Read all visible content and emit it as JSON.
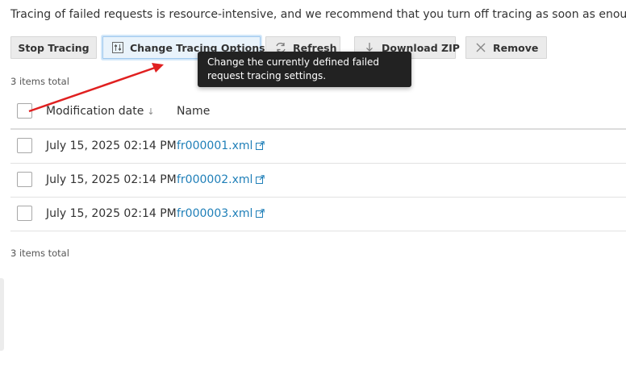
{
  "notice": "Tracing of failed requests is resource-intensive, and we recommend that you turn off tracing as soon as enough failed",
  "toolbar": {
    "stop_tracing": "Stop Tracing",
    "change_tracing_options": "Change Tracing Options",
    "refresh": "Refresh",
    "download_zip": "Download ZIP",
    "remove": "Remove"
  },
  "tooltip": "Change the currently defined failed request tracing settings.",
  "items_total_top": "3 items total",
  "items_total_bottom": "3 items total",
  "table": {
    "columns": {
      "modification_date": "Modification date",
      "name": "Name"
    },
    "rows": [
      {
        "date": "July 15, 2025 02:14 PM",
        "name": "fr000001.xml"
      },
      {
        "date": "July 15, 2025 02:14 PM",
        "name": "fr000002.xml"
      },
      {
        "date": "July 15, 2025 02:14 PM",
        "name": "fr000003.xml"
      }
    ]
  },
  "colors": {
    "link": "#1f7fb8",
    "annotation_arrow": "#e02020",
    "tooltip_bg": "#222222"
  },
  "icons": {
    "change_tracing_options": "sliders-icon",
    "refresh": "refresh-icon",
    "download_zip": "download-icon",
    "remove": "close-icon",
    "sort": "sort-down-icon",
    "external_link": "external-link-icon"
  }
}
